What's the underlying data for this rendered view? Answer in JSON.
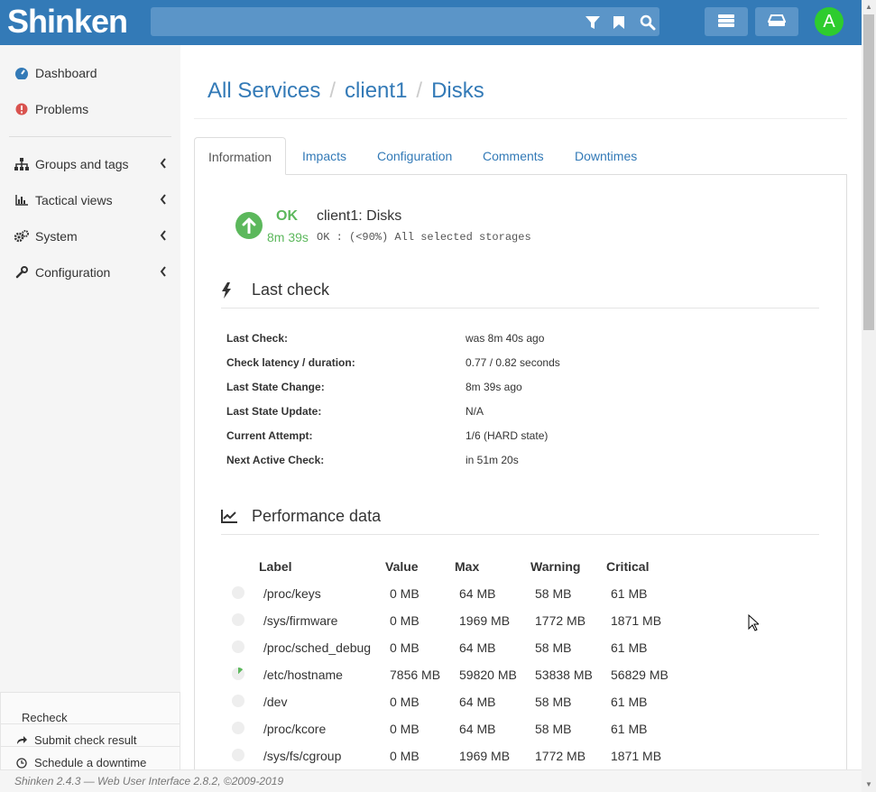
{
  "navbar": {
    "brand": "Shinken",
    "search_value": "",
    "avatar_letter": "A"
  },
  "sidebar": {
    "items": [
      {
        "label": "Dashboard",
        "icon": "dashboard-icon"
      },
      {
        "label": "Problems",
        "icon": "exclamation-circle-icon"
      },
      {
        "label": "Groups and tags",
        "icon": "sitemap-icon"
      },
      {
        "label": "Tactical views",
        "icon": "bar-chart-icon"
      },
      {
        "label": "System",
        "icon": "gears-icon"
      },
      {
        "label": "Configuration",
        "icon": "wrench-icon"
      }
    ],
    "actions": {
      "recheck": "Recheck",
      "submit": "Submit check result",
      "downtime": "Schedule a downtime"
    }
  },
  "breadcrumb": [
    "All Services",
    "client1",
    "Disks"
  ],
  "tabs": [
    "Information",
    "Impacts",
    "Configuration",
    "Comments",
    "Downtimes"
  ],
  "status": {
    "state": "OK",
    "duration": "8m 39s",
    "service": "client1: Disks",
    "output": "OK : (<90%) All selected storages",
    "color": "#5cb85c"
  },
  "last_check": {
    "title": "Last check",
    "rows": [
      {
        "label": "Last Check:",
        "value": "was 8m 40s ago"
      },
      {
        "label": "Check latency / duration:",
        "value": "0.77 / 0.82 seconds"
      },
      {
        "label": "Last State Change:",
        "value": "8m 39s ago"
      },
      {
        "label": "Last State Update:",
        "value": "N/A"
      },
      {
        "label": "Current Attempt:",
        "value": "1/6 (HARD state)"
      },
      {
        "label": "Next Active Check:",
        "value": "in 51m 20s"
      }
    ]
  },
  "perf": {
    "title": "Performance data",
    "headers": [
      "Label",
      "Value",
      "Max",
      "Warning",
      "Critical"
    ],
    "rows": [
      {
        "label": "/proc/keys",
        "value": "0 MB",
        "max": "64 MB",
        "warning": "58 MB",
        "critical": "61 MB",
        "used_fraction": 0
      },
      {
        "label": "/sys/firmware",
        "value": "0 MB",
        "max": "1969 MB",
        "warning": "1772 MB",
        "critical": "1871 MB",
        "used_fraction": 0
      },
      {
        "label": "/proc/sched_debug",
        "value": "0 MB",
        "max": "64 MB",
        "warning": "58 MB",
        "critical": "61 MB",
        "used_fraction": 0
      },
      {
        "label": "/etc/hostname",
        "value": "7856 MB",
        "max": "59820 MB",
        "warning": "53838 MB",
        "critical": "56829 MB",
        "used_fraction": 0.13
      },
      {
        "label": "/dev",
        "value": "0 MB",
        "max": "64 MB",
        "warning": "58 MB",
        "critical": "61 MB",
        "used_fraction": 0
      },
      {
        "label": "/proc/kcore",
        "value": "0 MB",
        "max": "64 MB",
        "warning": "58 MB",
        "critical": "61 MB",
        "used_fraction": 0
      },
      {
        "label": "/sys/fs/cgroup",
        "value": "0 MB",
        "max": "1969 MB",
        "warning": "1772 MB",
        "critical": "1871 MB",
        "used_fraction": 0
      }
    ]
  },
  "footer": "Shinken 2.4.3 — Web User Interface 2.8.2, ©2009-2019",
  "colors": {
    "brand": "#337ab7",
    "ok": "#5cb85c",
    "avatar": "#2ecc2e",
    "problem": "#d9534f"
  }
}
